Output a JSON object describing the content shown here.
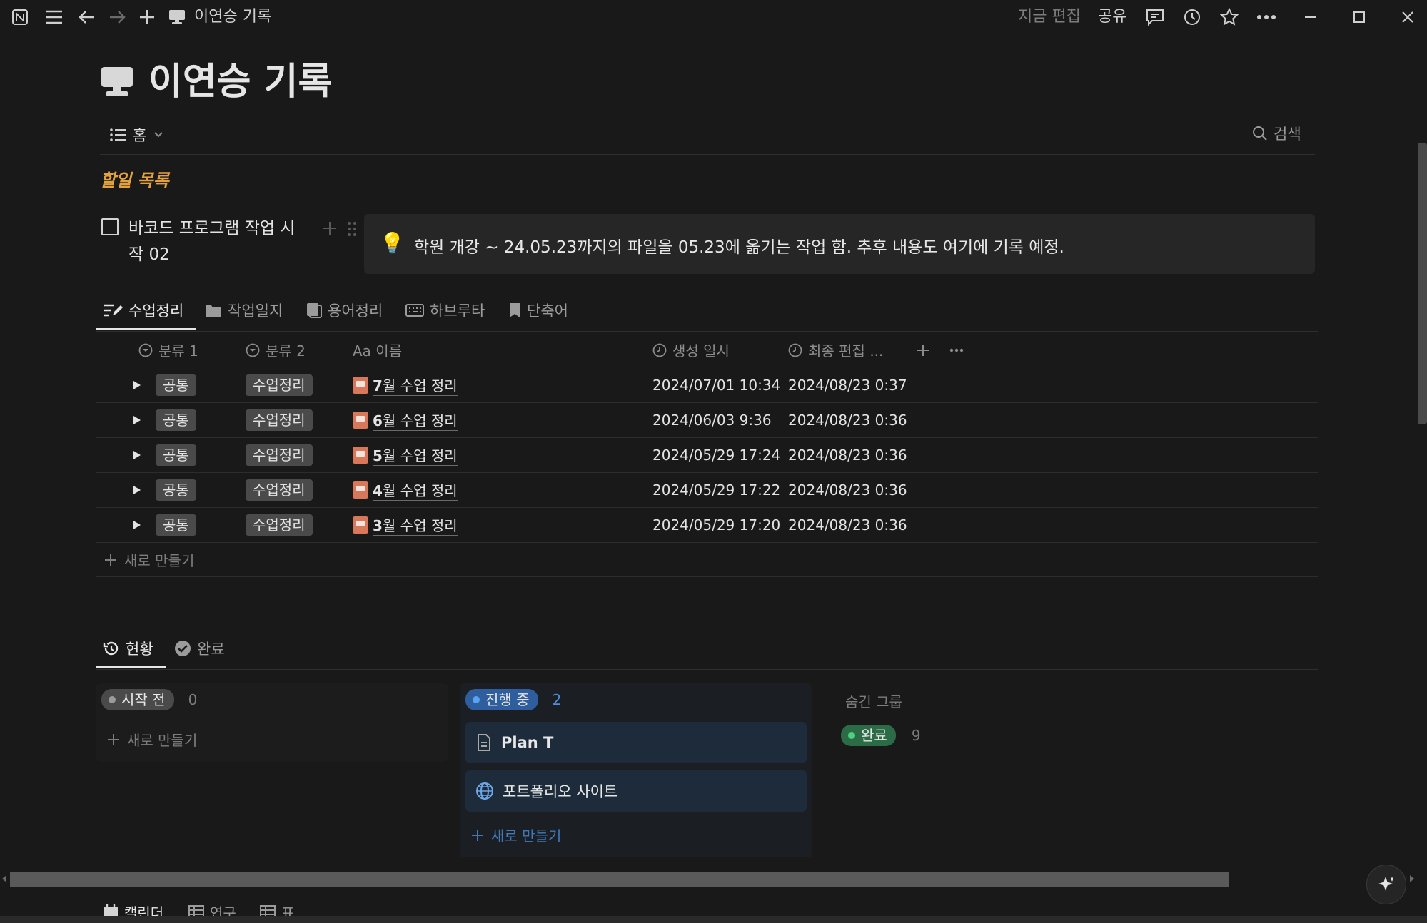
{
  "topbar": {
    "breadcrumb": "이연승 기록",
    "edit_status": "지금 편집",
    "share": "공유"
  },
  "page": {
    "title": "이연승 기록",
    "view_name": "홈",
    "search_label": "검색"
  },
  "todo": {
    "heading": "할일 목록",
    "item_line1": "바코드 프로그램 작업 시",
    "item_line2": "작 02",
    "checked": false
  },
  "callout": {
    "emoji": "💡",
    "text": "학원 개강 ~ 24.05.23까지의 파일을 05.23에 옮기는 작업 함. 추후 내용도 여기에 기록 예정."
  },
  "db_tabs": [
    "수업정리",
    "작업일지",
    "용어정리",
    "하브루타",
    "단축어"
  ],
  "table": {
    "columns": [
      "분류 1",
      "분류 2",
      "Aa 이름",
      "생성 일시",
      "최종 편집 ..."
    ],
    "rows": [
      {
        "cat1": "공통",
        "cat2": "수업정리",
        "name_num": "7",
        "name_rest": "월 수업 정리",
        "created": "2024/07/01 10:34",
        "edited": "2024/08/23 0:37"
      },
      {
        "cat1": "공통",
        "cat2": "수업정리",
        "name_num": "6",
        "name_rest": "월 수업 정리",
        "created": "2024/06/03 9:36",
        "edited": "2024/08/23 0:36"
      },
      {
        "cat1": "공통",
        "cat2": "수업정리",
        "name_num": "5",
        "name_rest": "월 수업 정리",
        "created": "2024/05/29 17:24",
        "edited": "2024/08/23 0:36"
      },
      {
        "cat1": "공통",
        "cat2": "수업정리",
        "name_num": "4",
        "name_rest": "월 수업 정리",
        "created": "2024/05/29 17:22",
        "edited": "2024/08/23 0:36"
      },
      {
        "cat1": "공통",
        "cat2": "수업정리",
        "name_num": "3",
        "name_rest": "월 수업 정리",
        "created": "2024/05/29 17:20",
        "edited": "2024/08/23 0:36"
      }
    ],
    "new_label": "새로 만들기"
  },
  "board_tabs": [
    "현황",
    "완료"
  ],
  "board": {
    "col1": {
      "label": "시작 전",
      "count": "0",
      "new_label": "새로 만들기"
    },
    "col2": {
      "label": "진행 중",
      "count": "2",
      "cards": [
        "Plan T",
        "포트폴리오 사이트"
      ],
      "new_label": "새로 만들기"
    },
    "hidden_title": "숨긴 그룹",
    "hidden_label": "완료",
    "hidden_count": "9"
  },
  "bottom_tabs": [
    "캘린더",
    "연구",
    "표"
  ],
  "colors": {
    "background": "#191919",
    "todo_heading": "#e2a03f",
    "status_blue": "#2e5e9e",
    "status_green": "#2b6b45",
    "page_icon": "#d9775a"
  }
}
